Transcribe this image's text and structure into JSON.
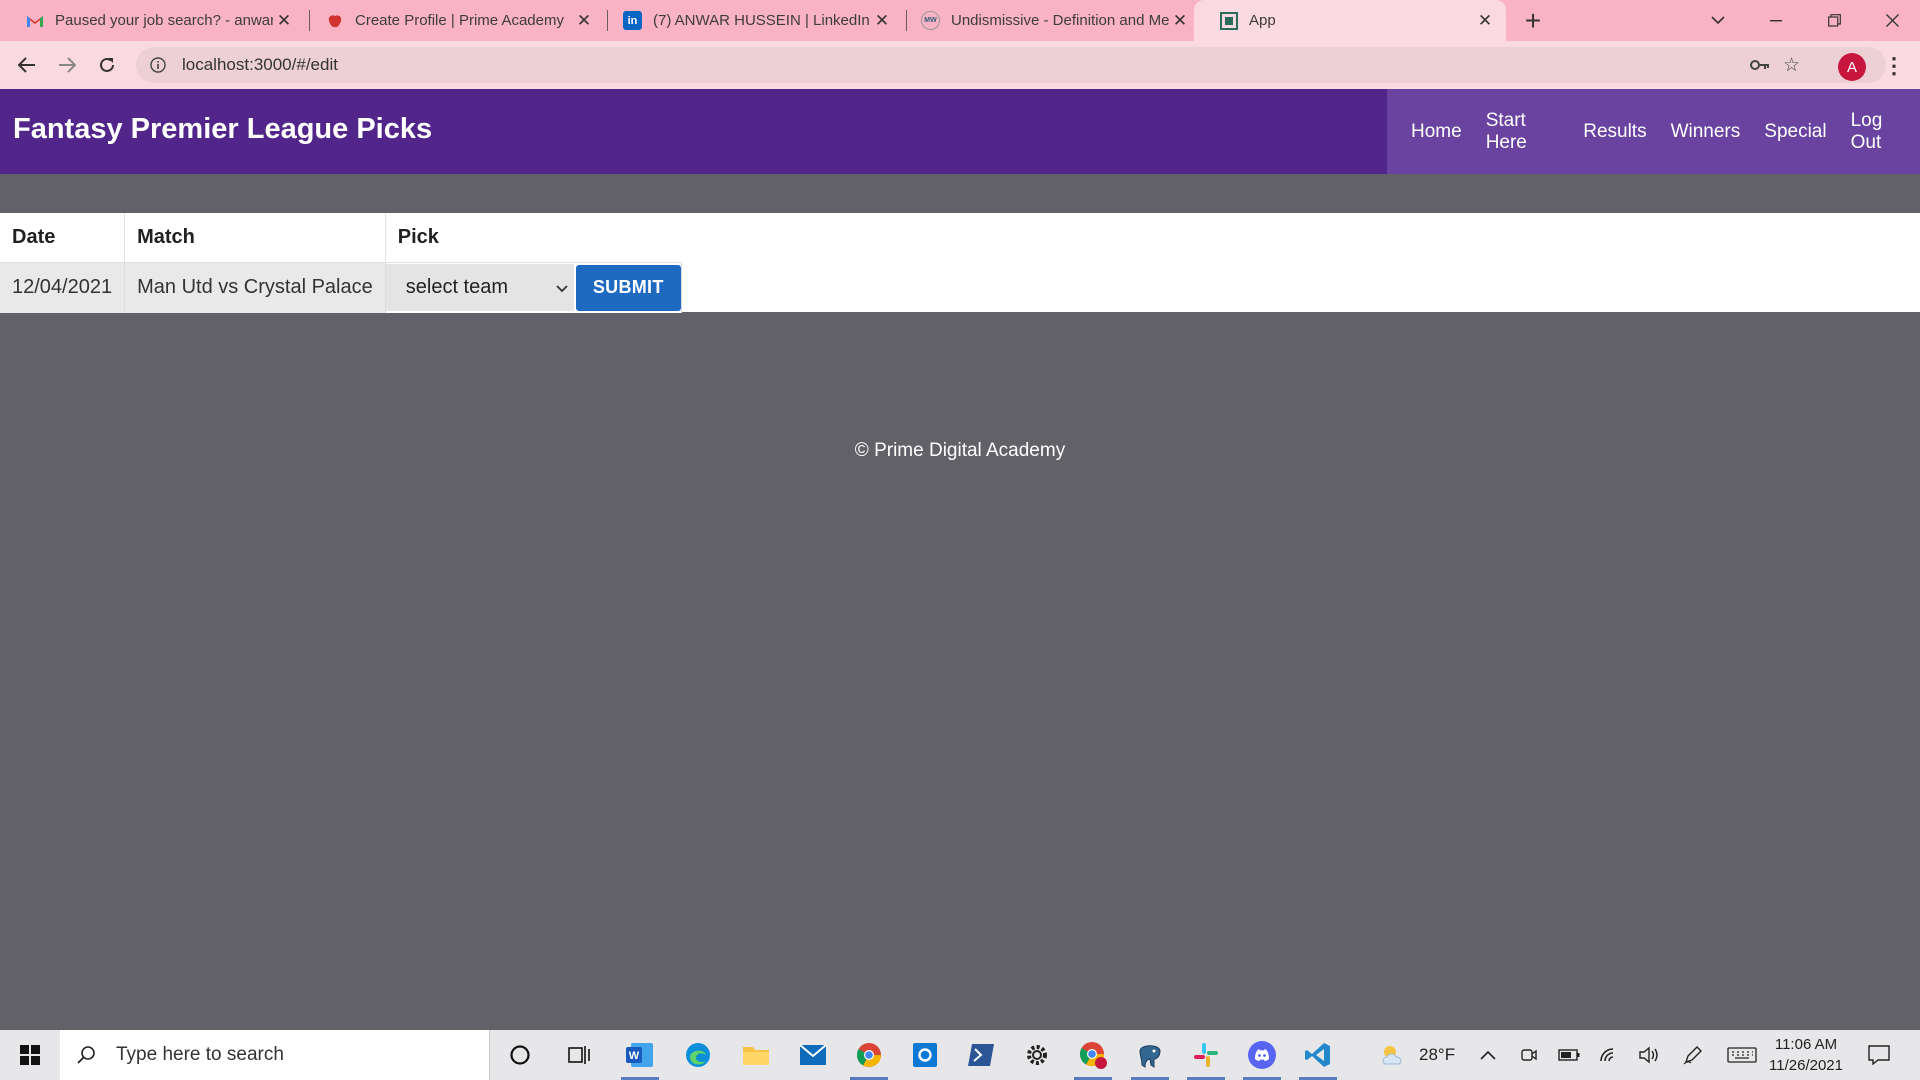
{
  "browser": {
    "tabs": [
      {
        "title": "Paused your job search? - anwar",
        "icon": "gmail-icon",
        "active": false
      },
      {
        "title": "Create Profile | Prime Academy",
        "icon": "prime-academy-icon",
        "active": false
      },
      {
        "title": "(7) ANWAR HUSSEIN | LinkedIn",
        "icon": "linkedin-icon",
        "active": false
      },
      {
        "title": "Undismissive - Definition and Me",
        "icon": "merriam-webster-icon",
        "active": false
      },
      {
        "title": "App",
        "icon": "app-icon",
        "active": true
      }
    ],
    "url": "localhost:3000/#/edit",
    "profile_initial": "A"
  },
  "app": {
    "title": "Fantasy Premier League Picks",
    "nav": [
      "Home",
      "Start Here",
      "Results",
      "Winners",
      "Special",
      "Log Out"
    ]
  },
  "table": {
    "headers": {
      "date": "Date",
      "match": "Match",
      "pick": "Pick"
    },
    "rows": [
      {
        "date": "12/04/2021",
        "match": "Man Utd vs Crystal Palace",
        "pick": "select team",
        "action": "SUBMIT"
      }
    ]
  },
  "footer": {
    "text": "© Prime Digital Academy"
  },
  "taskbar": {
    "search_placeholder": "Type here to search",
    "weather": "28°F",
    "time": "11:06 AM",
    "date": "11/26/2021",
    "apps": [
      "cortana-icon",
      "task-view-icon",
      "word-icon",
      "edge-icon",
      "file-explorer-icon",
      "mail-icon",
      "chrome-icon",
      "outlook-icon",
      "powershell-icon",
      "settings-icon",
      "chrome-profile-icon",
      "postgres-icon",
      "slack-icon",
      "discord-icon",
      "vscode-icon"
    ]
  },
  "colors": {
    "header": "#51258a",
    "nav_bg": "#6a43a0",
    "page_bg": "#626168",
    "submit": "#1f6ac1",
    "tab_strip": "#f9b3c4"
  }
}
